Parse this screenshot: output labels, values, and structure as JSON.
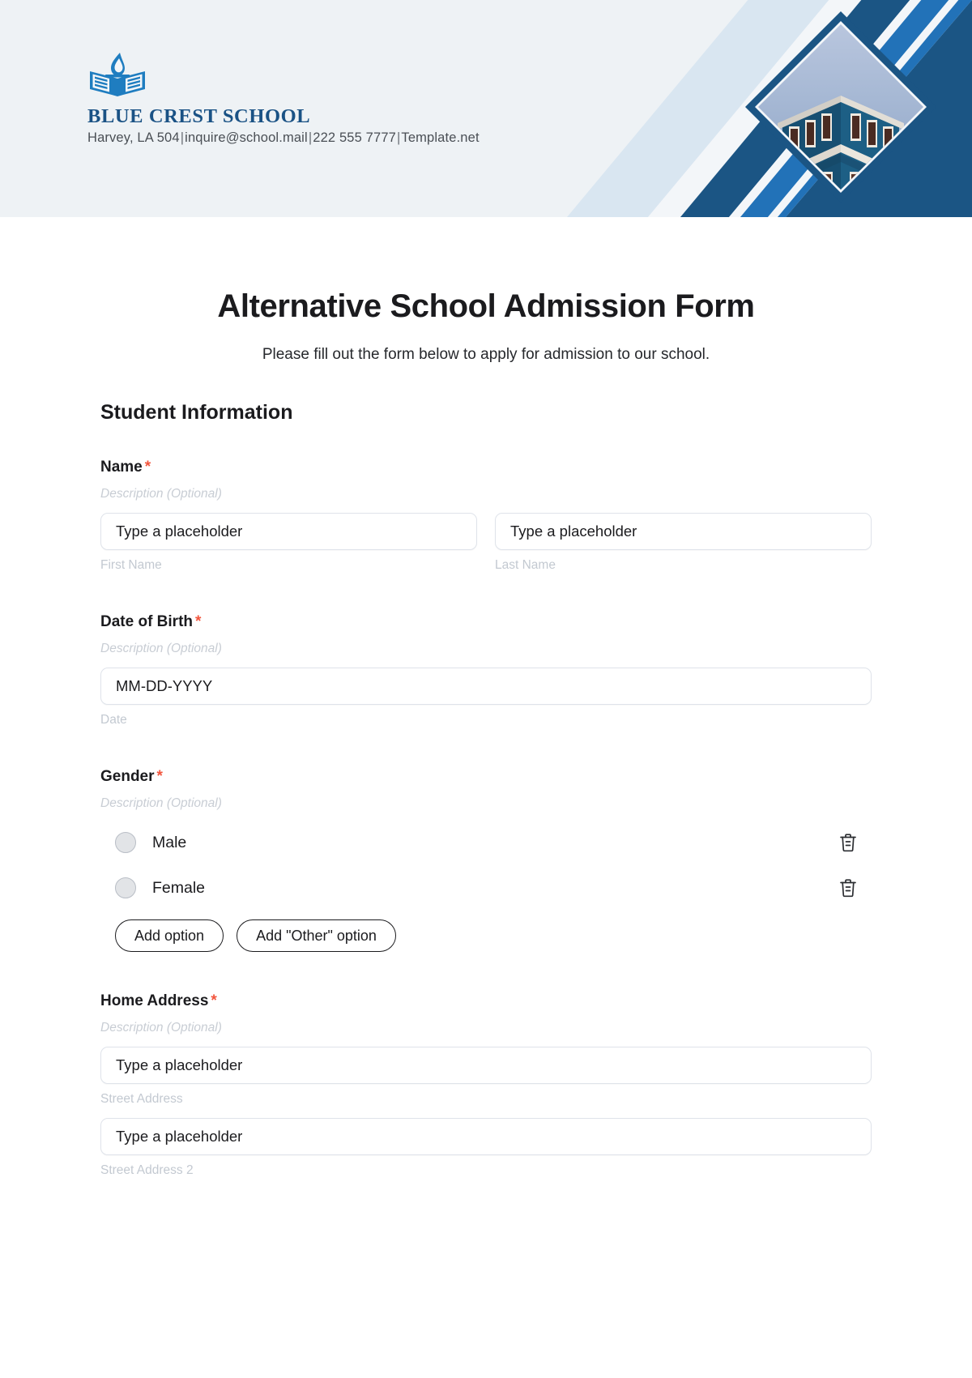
{
  "header": {
    "brand_name": "BLUE CREST SCHOOL",
    "contact": {
      "address": "Harvey, LA 504",
      "email": "inquire@school.mail",
      "phone": "222 555 7777",
      "website": "Template.net",
      "separator": "|"
    },
    "colors": {
      "background": "#eef2f5",
      "brand_navy": "#1a5285",
      "stripe_dark": "#1b5584",
      "stripe_mid": "#2272b8",
      "stripe_light": "#cfe0ee"
    }
  },
  "form": {
    "title": "Alternative School Admission Form",
    "subtitle": "Please fill out the form below to apply for admission to our school.",
    "section_heading": "Student Information",
    "required_marker": "*",
    "description_placeholder": "Description (Optional)",
    "fields": [
      {
        "label": "Name",
        "required": true,
        "description": "Description (Optional)",
        "inputs": [
          {
            "placeholder": "Type a placeholder",
            "sub_label": "First Name"
          },
          {
            "placeholder": "Type a placeholder",
            "sub_label": "Last Name"
          }
        ]
      },
      {
        "label": "Date of Birth",
        "required": true,
        "description": "Description (Optional)",
        "inputs": [
          {
            "placeholder": "MM-DD-YYYY",
            "sub_label": "Date"
          }
        ]
      },
      {
        "label": "Gender",
        "required": true,
        "description": "Description (Optional)",
        "options": [
          {
            "label": "Male",
            "selected": false,
            "delete_icon": "trash-icon"
          },
          {
            "label": "Female",
            "selected": false,
            "delete_icon": "trash-icon"
          }
        ],
        "buttons": [
          {
            "label": "Add option"
          },
          {
            "label": "Add \"Other\" option"
          }
        ]
      },
      {
        "label": "Home Address",
        "required": true,
        "description": "Description (Optional)",
        "inputs": [
          {
            "placeholder": "Type a placeholder",
            "sub_label": "Street Address"
          },
          {
            "placeholder": "Type a placeholder",
            "sub_label": "Street Address 2"
          }
        ]
      }
    ]
  }
}
